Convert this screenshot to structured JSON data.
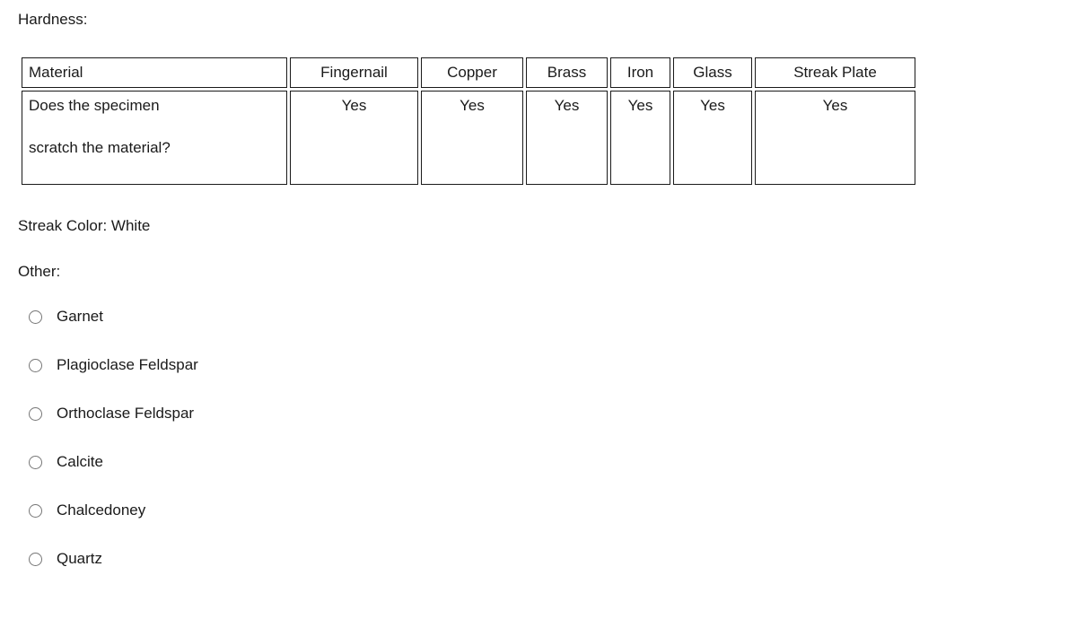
{
  "form": {
    "hardness_label": "Hardness:",
    "streak_color_label": "Streak Color: White",
    "other_label": "Other:"
  },
  "hardness_table": {
    "row_header_label": "Material",
    "row_question_line1": "Does the specimen",
    "row_question_line2": "scratch the material?",
    "columns": [
      {
        "header": "Fingernail",
        "value": "Yes"
      },
      {
        "header": "Copper",
        "value": "Yes"
      },
      {
        "header": "Brass",
        "value": "Yes"
      },
      {
        "header": "Iron",
        "value": "Yes"
      },
      {
        "header": "Glass",
        "value": "Yes"
      },
      {
        "header": "Streak Plate",
        "value": "Yes"
      }
    ]
  },
  "other_options": [
    {
      "label": "Garnet",
      "selected": false
    },
    {
      "label": "Plagioclase Feldspar",
      "selected": false
    },
    {
      "label": "Orthoclase Feldspar",
      "selected": false
    },
    {
      "label": "Calcite",
      "selected": false
    },
    {
      "label": "Chalcedoney",
      "selected": false
    },
    {
      "label": "Quartz",
      "selected": false
    }
  ],
  "colors": {
    "text": "#1a1a1a",
    "table_border": "#1a1a1a",
    "radio_border": "#767676",
    "background": "#ffffff"
  }
}
